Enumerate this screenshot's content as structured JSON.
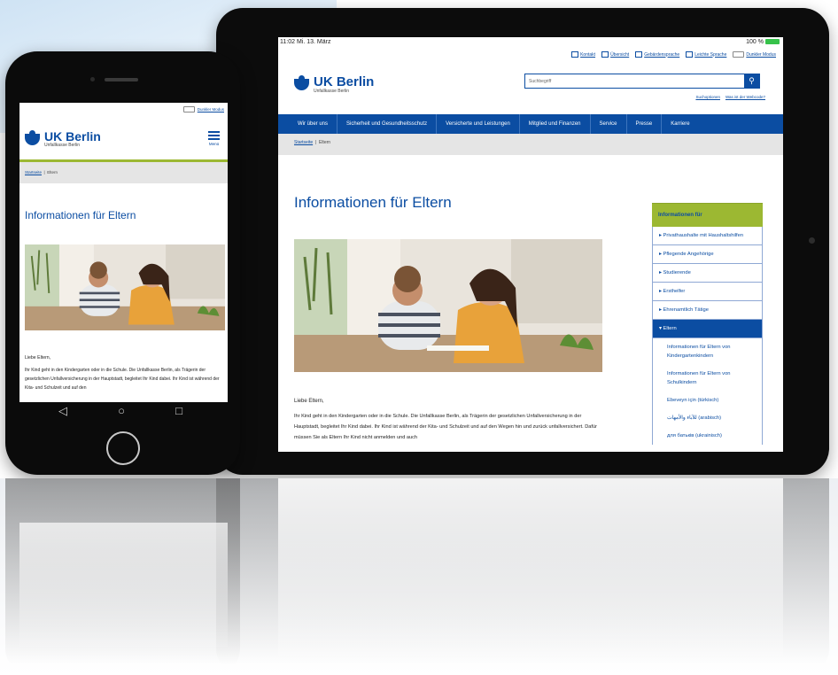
{
  "colors": {
    "brand_blue": "#0b4da2",
    "accent_green": "#9cb832",
    "nav_text": "#ffffff",
    "crumb_bg": "#e5e5e5"
  },
  "tablet": {
    "status": {
      "time_date": "11:02  Mi. 13. März",
      "battery": "100 %"
    },
    "toplinks": [
      "Kontakt",
      "Übersicht",
      "Gebärdensprache",
      "Leichte Sprache",
      "Dunkler Modus"
    ],
    "logo": {
      "name": "UK Berlin",
      "sub": "Unfallkasse Berlin"
    },
    "search": {
      "placeholder": "Suchbegriff",
      "button_icon": "search-icon"
    },
    "header_links": [
      "Suchoptionen",
      "Was ist der Webcode?"
    ],
    "nav": [
      "Wir über uns",
      "Sicherheit und Gesundheitsschutz",
      "Versicherte und Leistungen",
      "Mitglied und Finanzen",
      "Service",
      "Presse",
      "Karriere"
    ],
    "breadcrumb": {
      "home": "Startseite",
      "current": "Eltern"
    },
    "page_title": "Informationen für Eltern",
    "greeting": "Liebe Eltern,",
    "body": "Ihr Kind geht in den Kindergarten oder in die Schule. Die Unfallkasse Berlin, als Trägerin der gesetzlichen Unfallversicherung in der Hauptstadt, begleitet Ihr Kind dabei. Ihr Kind ist während der Kita- und Schulzeit und auf den Wegen hin und zurück unfallversichert. Dafür müssen Sie als Eltern Ihr Kind nicht anmelden und auch",
    "sidebar": {
      "heading": "Informationen für",
      "items": [
        "Privathaushalte mit Haushaltshilfen",
        "Pflegende Angehörige",
        "Studierende",
        "Ersthelfer",
        "Ehrenamtlich Tätige",
        "Eltern"
      ],
      "subitems": [
        "Informationen für Eltern von Kindergartenkindern",
        "Informationen für Eltern von Schulkindern",
        "Ebeveyn için (türkisch)",
        "للآباء والأمهات (arabisch)",
        "для батьків (ukrainisch)"
      ]
    }
  },
  "phone": {
    "dark_mode": "Dunkler Modus",
    "logo": {
      "name": "UK Berlin",
      "sub": "Unfallkasse Berlin"
    },
    "menu_label": "Menü",
    "breadcrumb": {
      "home": "Startseite",
      "current": "Eltern"
    },
    "page_title": "Informationen für Eltern",
    "greeting": "Liebe Eltern,",
    "body": "Ihr Kind geht in den Kindergarten oder in die Schule. Die Unfallkasse Berlin, als Trägerin der gesetzlichen Unfallversicherung in der Hauptstadt, begleitet Ihr Kind dabei. Ihr Kind ist während der Kita- und Schulzeit und auf den",
    "nav_buttons": [
      "◁",
      "○",
      "□"
    ]
  }
}
